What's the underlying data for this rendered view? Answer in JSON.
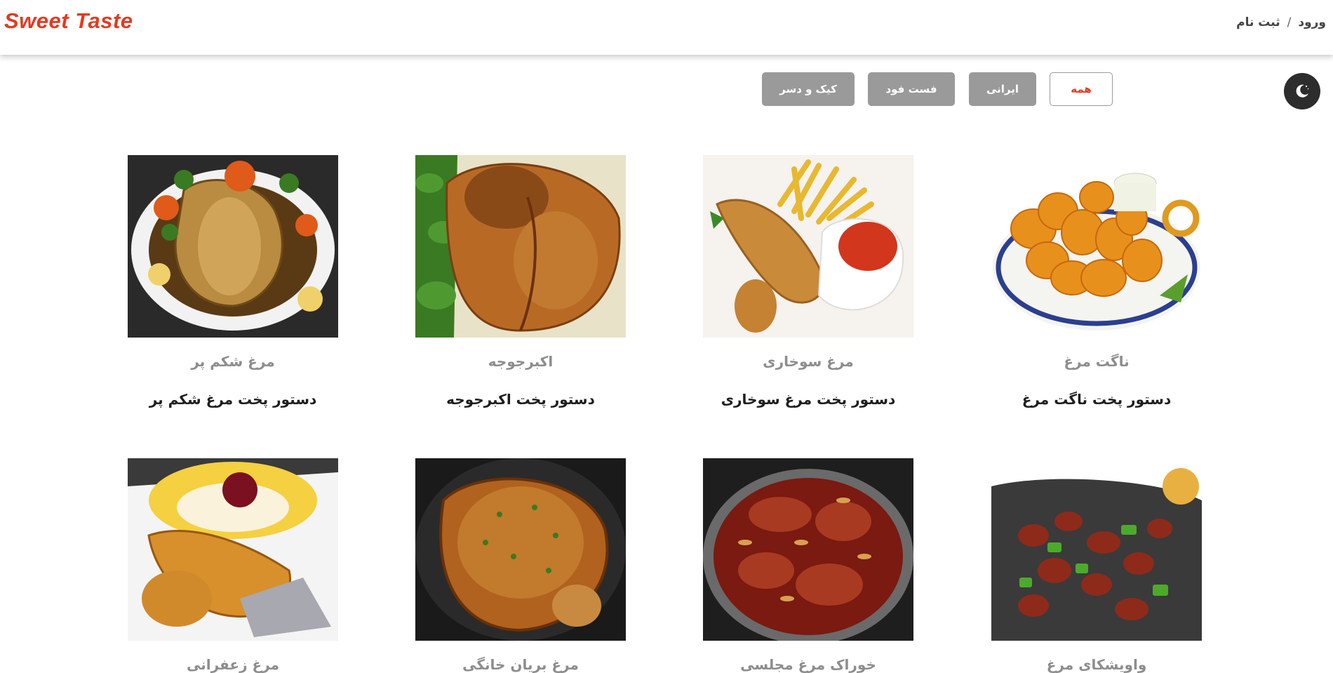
{
  "header": {
    "logo": "Sweet Taste",
    "login": "ورود",
    "separator": "/",
    "register": "ثبت نام"
  },
  "theme_toggle": {
    "icon": "moon-icon"
  },
  "filters": [
    {
      "label": "همه",
      "active": true
    },
    {
      "label": "ایرانی",
      "active": false
    },
    {
      "label": "فست فود",
      "active": false
    },
    {
      "label": "کیک و دسر",
      "active": false
    }
  ],
  "recipes": [
    {
      "title": "ناگت مرغ",
      "desc": "دستور پخت ناگت مرغ"
    },
    {
      "title": "مرغ سوخاری",
      "desc": "دستور پخت مرغ سوخاری"
    },
    {
      "title": "اکبرجوجه",
      "desc": "دستور پخت اکبرجوجه"
    },
    {
      "title": "مرغ شکم پر",
      "desc": "دستور پخت مرغ شکم پر"
    },
    {
      "title": "واویشکای مرغ",
      "desc": ""
    },
    {
      "title": "خوراک مرغ مجلسی",
      "desc": ""
    },
    {
      "title": "مرغ بریان خانگی",
      "desc": ""
    },
    {
      "title": "مرغ زعفرانی",
      "desc": ""
    }
  ],
  "colors": {
    "brand": "#e33a1f",
    "button_gray": "#9a9a9a",
    "theme_button": "#2d2d2d"
  }
}
